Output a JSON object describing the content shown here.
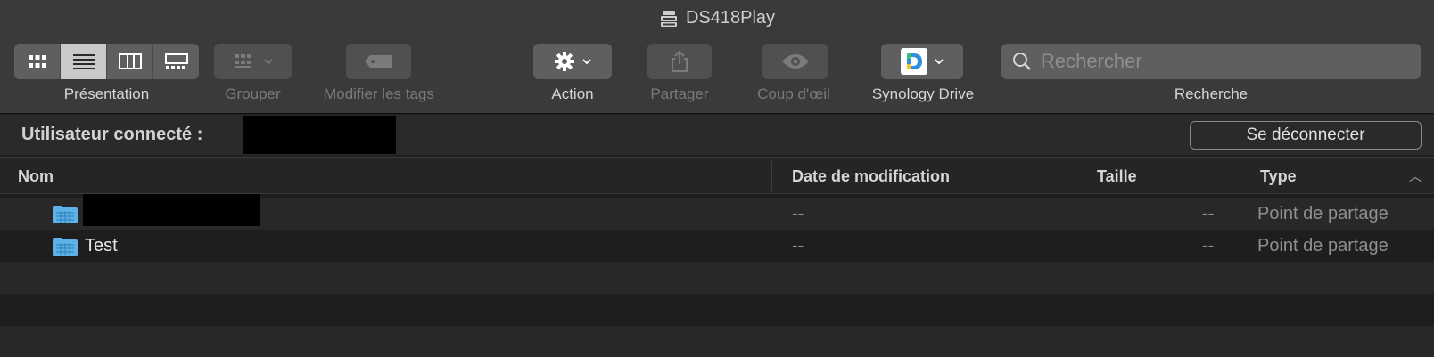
{
  "window": {
    "title": "DS418Play"
  },
  "toolbar": {
    "presentation_label": "Présentation",
    "group_label": "Grouper",
    "tags_label": "Modifier les tags",
    "action_label": "Action",
    "share_label": "Partager",
    "quicklook_label": "Coup d'œil",
    "drive_label": "Synology Drive",
    "search_label": "Recherche"
  },
  "search": {
    "placeholder": "Rechercher",
    "value": ""
  },
  "userbar": {
    "label": "Utilisateur connecté :",
    "logout_label": "Se déconnecter"
  },
  "table": {
    "columns": {
      "name": "Nom",
      "date": "Date de modification",
      "size": "Taille",
      "type": "Type"
    },
    "rows": [
      {
        "name": "",
        "date": "--",
        "size": "--",
        "type": "Point de partage",
        "redacted": true
      },
      {
        "name": "Test",
        "date": "--",
        "size": "--",
        "type": "Point de partage"
      }
    ]
  },
  "colors": {
    "toolbar_bg": "#3a3a3c",
    "window_bg": "#1e1e1e",
    "folder_blue": "#5bb3e8",
    "drive_green": "#3cc27a",
    "drive_blue": "#2f8fdd"
  },
  "icons": [
    "server-icon",
    "icon-view-icon",
    "list-view-icon",
    "column-view-icon",
    "gallery-view-icon",
    "group-icon",
    "tag-icon",
    "gear-icon",
    "share-icon",
    "eye-icon",
    "synology-drive-icon",
    "search-icon",
    "sort-ascending-icon",
    "folder-icon"
  ]
}
